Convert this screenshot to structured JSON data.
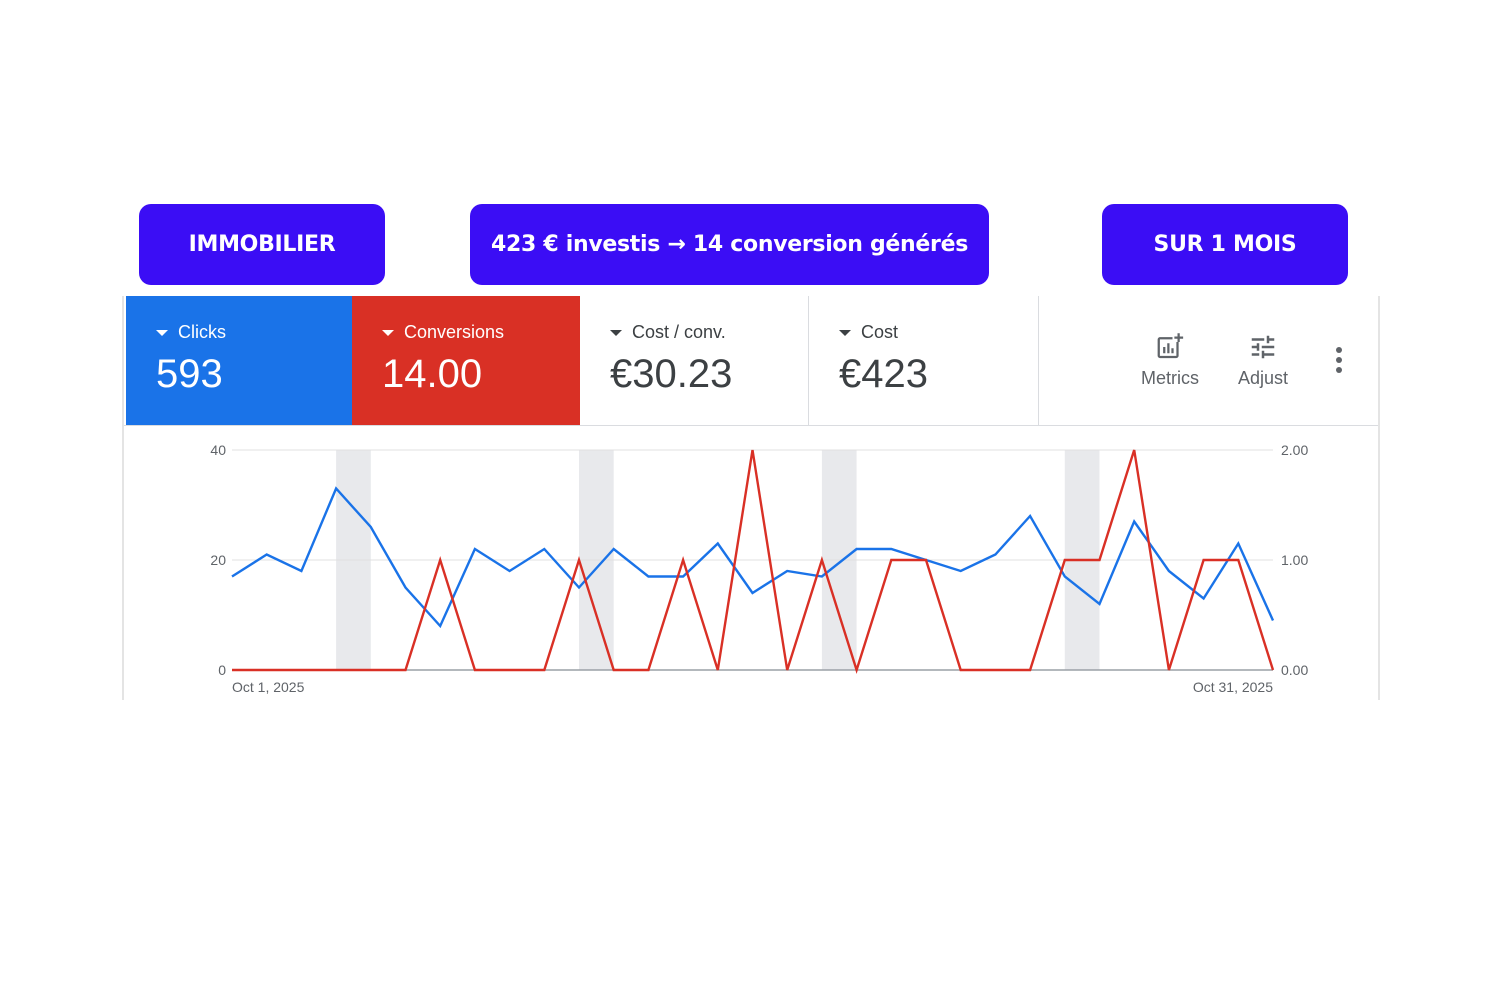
{
  "banners": {
    "left": "IMMOBILIER",
    "middle": "423 € investis → 14 conversion générés",
    "right": "SUR 1 MOIS"
  },
  "metrics": [
    {
      "label": "Clicks",
      "value": "593",
      "color": "#1a73e8"
    },
    {
      "label": "Conversions",
      "value": "14.00",
      "color": "#d93025"
    },
    {
      "label": "Cost / conv.",
      "value": "€30.23"
    },
    {
      "label": "Cost",
      "value": "€423"
    }
  ],
  "toolbar": {
    "metrics_label": "Metrics",
    "adjust_label": "Adjust",
    "metrics_icon": "add-chart-icon",
    "adjust_icon": "tune-icon",
    "more_icon": "more-vert-icon"
  },
  "chart_data": {
    "type": "line",
    "x_start_label": "Oct 1, 2025",
    "x_end_label": "Oct 31, 2025",
    "x": [
      "Oct 1",
      "Oct 2",
      "Oct 3",
      "Oct 4",
      "Oct 5",
      "Oct 6",
      "Oct 7",
      "Oct 8",
      "Oct 9",
      "Oct 10",
      "Oct 11",
      "Oct 12",
      "Oct 13",
      "Oct 14",
      "Oct 15",
      "Oct 16",
      "Oct 17",
      "Oct 18",
      "Oct 19",
      "Oct 20",
      "Oct 21",
      "Oct 22",
      "Oct 23",
      "Oct 24",
      "Oct 25",
      "Oct 26",
      "Oct 27",
      "Oct 28",
      "Oct 29",
      "Oct 30",
      "Oct 31"
    ],
    "left_axis": {
      "ticks": [
        "0",
        "20",
        "40"
      ],
      "range": [
        0,
        40
      ]
    },
    "right_axis": {
      "ticks": [
        "0.00",
        "1.00",
        "2.00"
      ],
      "range": [
        0,
        2
      ]
    },
    "weekend_bands": [
      [
        "Oct 4",
        "Oct 5"
      ],
      [
        "Oct 11",
        "Oct 12"
      ],
      [
        "Oct 18",
        "Oct 19"
      ],
      [
        "Oct 25",
        "Oct 26"
      ]
    ],
    "series": [
      {
        "name": "Clicks",
        "axis": "left",
        "color": "#1a73e8",
        "values": [
          17,
          21,
          18,
          33,
          26,
          15,
          8,
          22,
          18,
          22,
          15,
          22,
          17,
          17,
          23,
          14,
          18,
          17,
          22,
          22,
          20,
          18,
          21,
          28,
          17,
          12,
          27,
          18,
          13,
          23,
          9
        ]
      },
      {
        "name": "Conversions",
        "axis": "right",
        "color": "#d93025",
        "values": [
          0,
          0,
          0,
          0,
          0,
          0,
          1,
          0,
          0,
          0,
          1,
          0,
          0,
          1,
          0,
          2,
          0,
          1,
          0,
          1,
          1,
          0,
          0,
          0,
          1,
          1,
          2,
          0,
          1,
          1,
          0
        ]
      }
    ],
    "grid": true
  }
}
